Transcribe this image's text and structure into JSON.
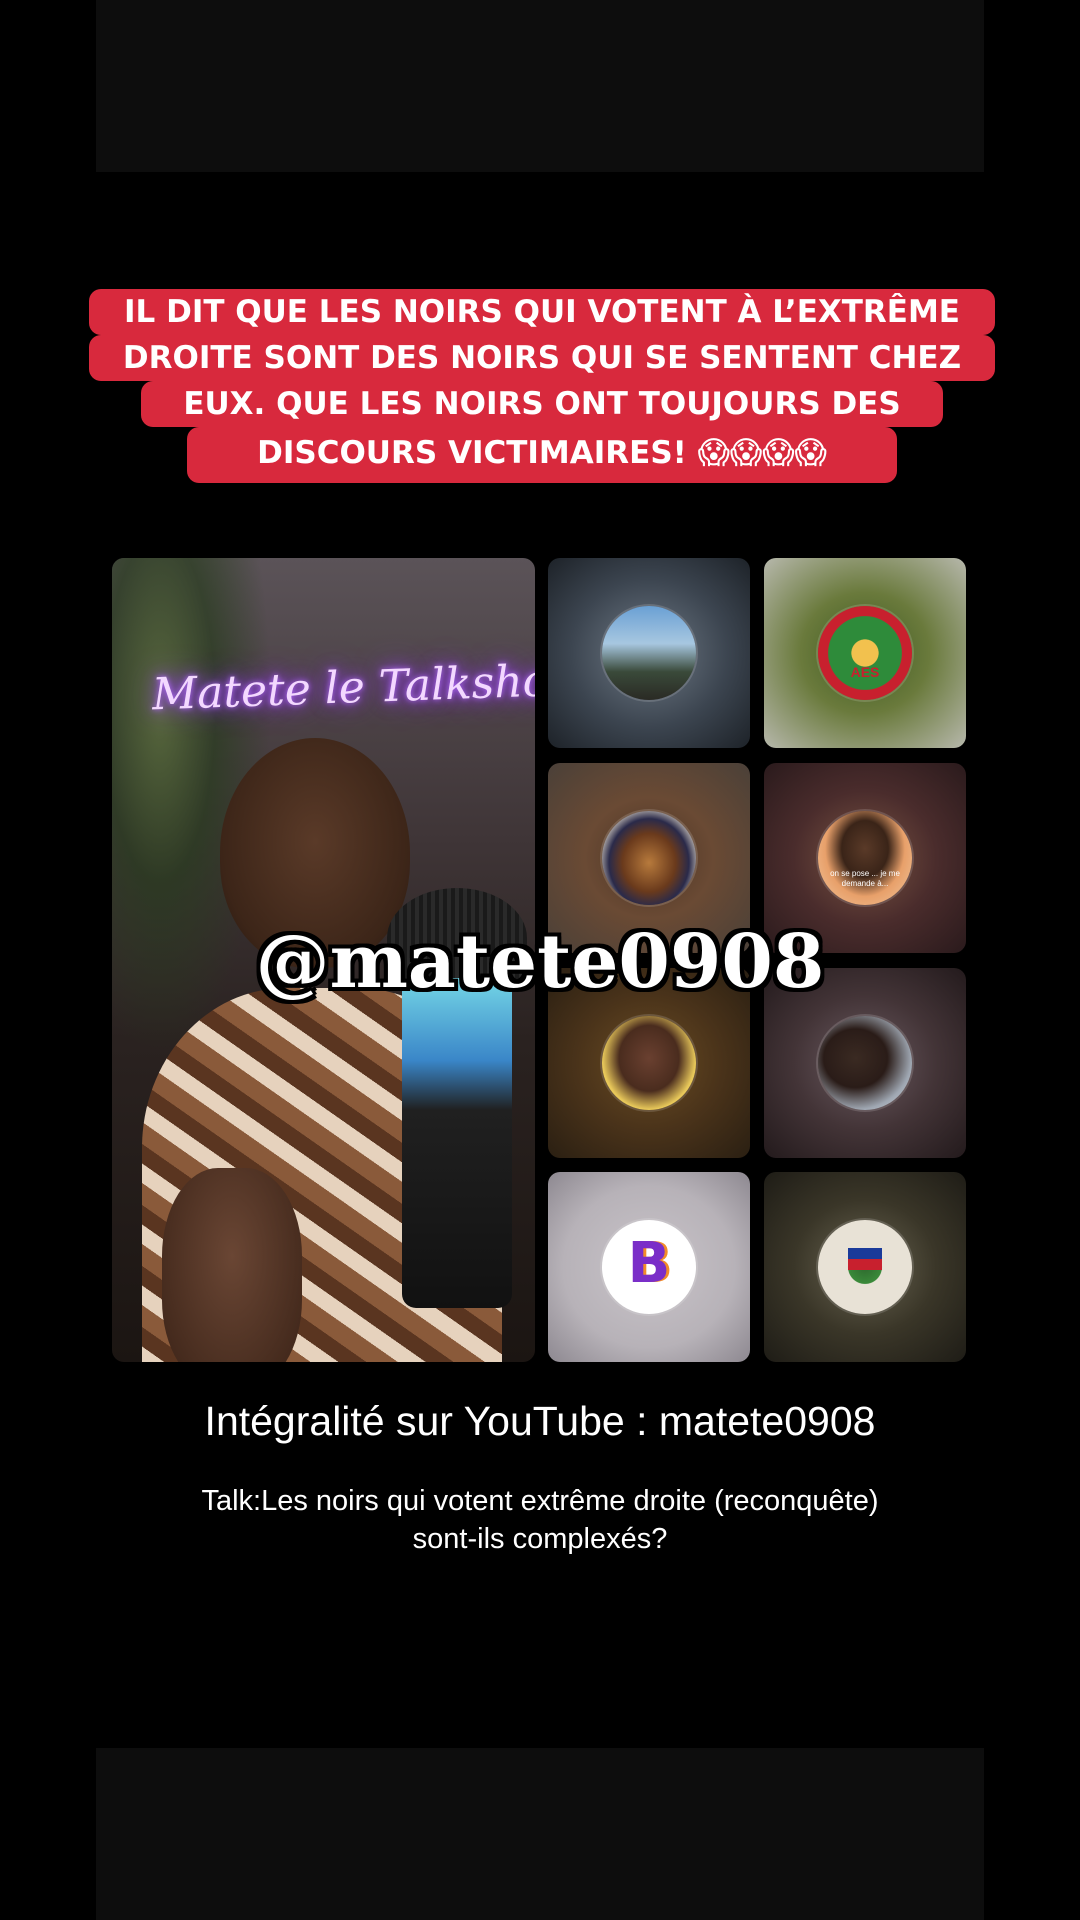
{
  "banner": {
    "line1": "IL DIT QUE LES NOIRS QUI VOTENT À L’EXTRÊME",
    "line2": "DROITE SONT DES NOIRS QUI SE SENTENT CHEZ",
    "line3": "EUX. QUE LES NOIRS ONT TOUJOURS DES",
    "line4": "DISCOURS VICTIMAIRES! 😱😱😱😱",
    "background_color": "#d8293d"
  },
  "host": {
    "neon_sign": "Matete le Talkshow"
  },
  "guests": [
    {
      "avatar": "landscape-trees-avatar"
    },
    {
      "avatar": "aes-emblem-avatar",
      "emblem_text": "AES"
    },
    {
      "avatar": "food-plate-avatar"
    },
    {
      "avatar": "man-portrait-avatar",
      "caption": "on se pose ... je me demande à..."
    },
    {
      "avatar": "young-man-portrait-avatar"
    },
    {
      "avatar": "man-suit-portrait-avatar"
    },
    {
      "avatar": "b-logo-avatar",
      "logo_letter": "B"
    },
    {
      "avatar": "haiti-seal-avatar"
    }
  ],
  "watermark": {
    "handle": "@matete0908"
  },
  "captions": {
    "youtube": "Intégralité sur YouTube : matete0908",
    "talk_line1": "Talk:Les noirs qui votent extrême droite (reconquête)",
    "talk_line2": "sont-ils complexés?"
  }
}
